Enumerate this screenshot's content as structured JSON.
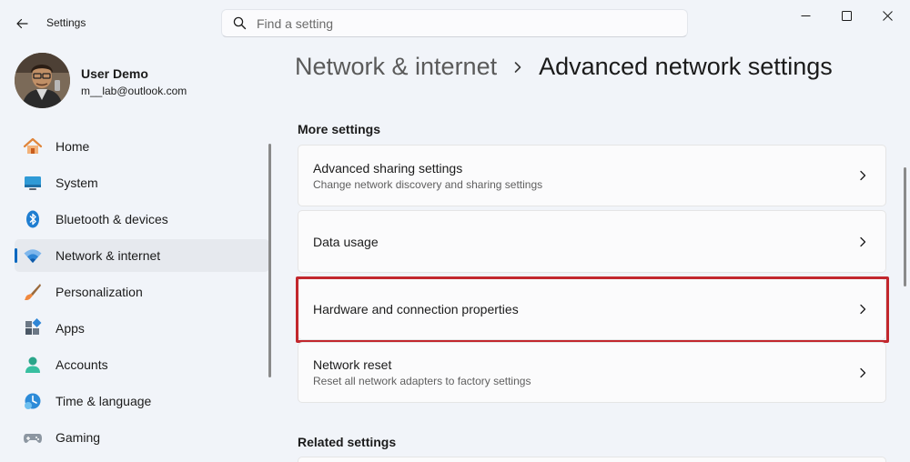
{
  "window": {
    "app_title": "Settings",
    "back_icon": "back-arrow-icon",
    "controls": [
      "minimize-icon",
      "maximize-icon",
      "close-icon"
    ]
  },
  "search": {
    "placeholder": "Find a setting",
    "value": "",
    "icon": "search-icon"
  },
  "profile": {
    "name": "User Demo",
    "email": "m__lab@outlook.com"
  },
  "sidebar": {
    "items": [
      {
        "label": "Home",
        "icon": "home-icon",
        "active": false
      },
      {
        "label": "System",
        "icon": "monitor-icon",
        "active": false
      },
      {
        "label": "Bluetooth & devices",
        "icon": "bluetooth-icon",
        "active": false
      },
      {
        "label": "Network & internet",
        "icon": "wifi-icon",
        "active": true
      },
      {
        "label": "Personalization",
        "icon": "paintbrush-icon",
        "active": false
      },
      {
        "label": "Apps",
        "icon": "apps-icon",
        "active": false
      },
      {
        "label": "Accounts",
        "icon": "person-icon",
        "active": false
      },
      {
        "label": "Time & language",
        "icon": "clock-globe-icon",
        "active": false
      },
      {
        "label": "Gaming",
        "icon": "gamepad-icon",
        "active": false
      }
    ]
  },
  "breadcrumb": {
    "parent": "Network & internet",
    "current": "Advanced network settings"
  },
  "sections": {
    "more_settings": {
      "title": "More settings",
      "items": [
        {
          "title": "Advanced sharing settings",
          "subtitle": "Change network discovery and sharing settings"
        },
        {
          "title": "Data usage",
          "subtitle": ""
        },
        {
          "title": "Hardware and connection properties",
          "subtitle": "",
          "highlighted": true
        },
        {
          "title": "Network reset",
          "subtitle": "Reset all network adapters to factory settings"
        }
      ]
    },
    "related_settings": {
      "title": "Related settings"
    }
  },
  "colors": {
    "accent": "#0067c0",
    "highlight_border": "#c2272d",
    "background": "#f1f4f9"
  }
}
